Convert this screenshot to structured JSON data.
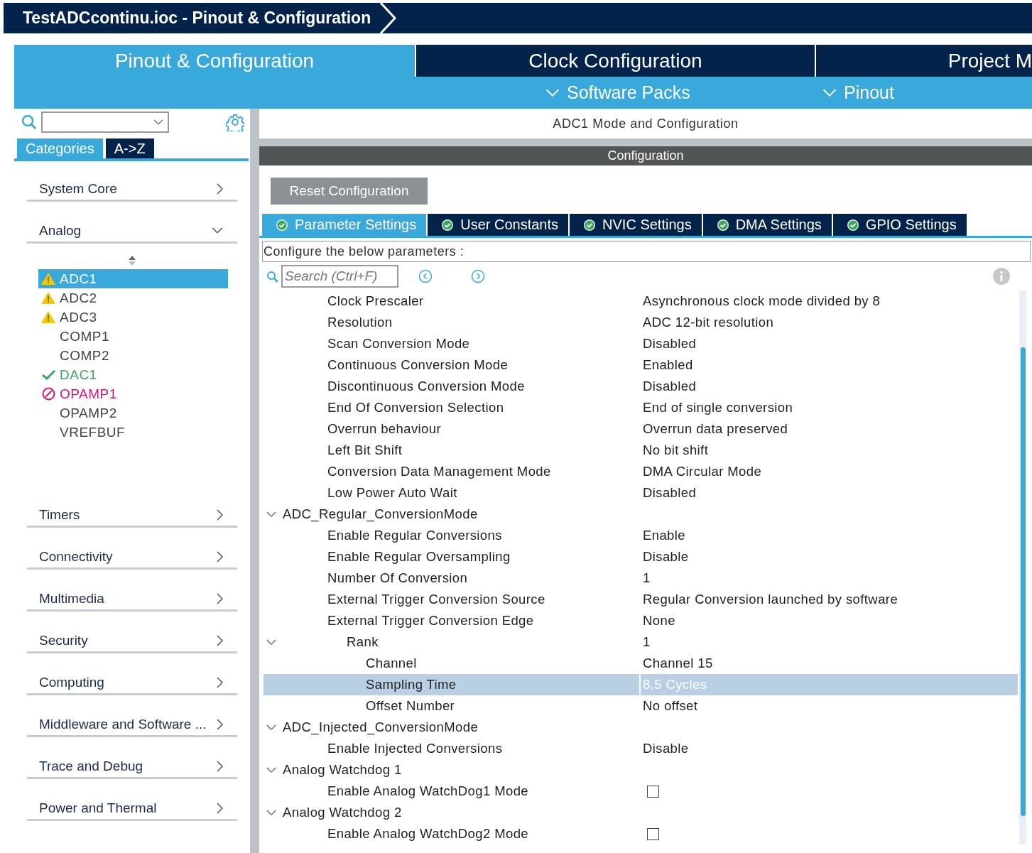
{
  "window": {
    "title": "TestADCcontinu.ioc - Pinout & Configuration"
  },
  "main_tabs": [
    {
      "label": "Pinout & Configuration",
      "selected": true
    },
    {
      "label": "Clock Configuration",
      "selected": false
    },
    {
      "label": "Project M",
      "selected": false
    }
  ],
  "sub_menu": [
    "Software Packs",
    "Pinout"
  ],
  "sidebar": {
    "view_tabs": [
      {
        "label": "Categories",
        "selected": true
      },
      {
        "label": "A->Z",
        "selected": false
      }
    ],
    "categories": [
      {
        "label": "System Core",
        "expanded": false
      },
      {
        "label": "Analog",
        "expanded": true,
        "items": [
          {
            "label": "ADC1",
            "kind": "warning",
            "selected": true
          },
          {
            "label": "ADC2",
            "kind": "warning",
            "selected": false
          },
          {
            "label": "ADC3",
            "kind": "warning",
            "selected": false
          },
          {
            "label": "COMP1",
            "kind": "plain",
            "selected": false
          },
          {
            "label": "COMP2",
            "kind": "plain",
            "selected": false
          },
          {
            "label": "DAC1",
            "kind": "ok",
            "selected": false
          },
          {
            "label": "OPAMP1",
            "kind": "error",
            "selected": false
          },
          {
            "label": "OPAMP2",
            "kind": "plain",
            "selected": false
          },
          {
            "label": "VREFBUF",
            "kind": "plain",
            "selected": false
          }
        ]
      },
      {
        "label": "Timers",
        "expanded": false
      },
      {
        "label": "Connectivity",
        "expanded": false
      },
      {
        "label": "Multimedia",
        "expanded": false
      },
      {
        "label": "Security",
        "expanded": false
      },
      {
        "label": "Computing",
        "expanded": false
      },
      {
        "label": "Middleware and Software ...",
        "expanded": false
      },
      {
        "label": "Trace and Debug",
        "expanded": false
      },
      {
        "label": "Power and Thermal",
        "expanded": false
      }
    ]
  },
  "panel": {
    "title": "ADC1 Mode and Configuration",
    "section": "Configuration",
    "reset_button": "Reset Configuration",
    "tabs": [
      {
        "label": "Parameter Settings",
        "selected": true
      },
      {
        "label": "User Constants",
        "selected": false
      },
      {
        "label": "NVIC Settings",
        "selected": false
      },
      {
        "label": "DMA Settings",
        "selected": false
      },
      {
        "label": "GPIO Settings",
        "selected": false
      }
    ],
    "description": "Configure the below parameters :",
    "search": {
      "placeholder": "Search (Ctrl+F)"
    },
    "parameters": [
      {
        "kind": "param",
        "name": "Clock Prescaler",
        "value": "Asynchronous clock mode divided by 8",
        "selected": false
      },
      {
        "kind": "param",
        "name": "Resolution",
        "value": "ADC 12-bit resolution",
        "selected": false
      },
      {
        "kind": "param",
        "name": "Scan Conversion Mode",
        "value": "Disabled",
        "selected": false
      },
      {
        "kind": "param",
        "name": "Continuous Conversion Mode",
        "value": "Enabled",
        "selected": false
      },
      {
        "kind": "param",
        "name": "Discontinuous Conversion Mode",
        "value": "Disabled",
        "selected": false
      },
      {
        "kind": "param",
        "name": "End Of Conversion Selection",
        "value": "End of single conversion",
        "selected": false
      },
      {
        "kind": "param",
        "name": "Overrun behaviour",
        "value": "Overrun data preserved",
        "selected": false
      },
      {
        "kind": "param",
        "name": "Left Bit Shift",
        "value": "No bit shift",
        "selected": false
      },
      {
        "kind": "param",
        "name": "Conversion Data Management Mode",
        "value": "DMA Circular Mode",
        "selected": false
      },
      {
        "kind": "param",
        "name": "Low Power Auto Wait",
        "value": "Disabled",
        "selected": false
      },
      {
        "kind": "group",
        "name": "ADC_Regular_ConversionMode",
        "expanded": true,
        "children": [
          {
            "kind": "param",
            "name": "Enable Regular Conversions",
            "value": "Enable",
            "selected": false
          },
          {
            "kind": "param",
            "name": "Enable Regular Oversampling",
            "value": "Disable",
            "selected": false
          },
          {
            "kind": "param",
            "name": "Number Of Conversion",
            "value": "1",
            "selected": false
          },
          {
            "kind": "param",
            "name": "External Trigger Conversion Source",
            "value": "Regular Conversion launched by software",
            "selected": false
          },
          {
            "kind": "param",
            "name": "External Trigger Conversion Edge",
            "value": "None",
            "selected": false
          },
          {
            "kind": "group",
            "name": "Rank",
            "value": "1",
            "expanded": true,
            "children": [
              {
                "kind": "param",
                "name": "Channel",
                "value": "Channel 15",
                "selected": false
              },
              {
                "kind": "param",
                "name": "Sampling Time",
                "value": "8.5 Cycles",
                "selected": true
              },
              {
                "kind": "param",
                "name": "Offset Number",
                "value": "No offset",
                "selected": false
              }
            ]
          }
        ]
      },
      {
        "kind": "group",
        "name": "ADC_Injected_ConversionMode",
        "expanded": true,
        "children": [
          {
            "kind": "param",
            "name": "Enable Injected Conversions",
            "value": "Disable",
            "selected": false
          }
        ]
      },
      {
        "kind": "group",
        "name": "Analog Watchdog 1",
        "expanded": true,
        "children": [
          {
            "kind": "checkbox",
            "name": "Enable Analog WatchDog1 Mode",
            "checked": false,
            "selected": false
          }
        ]
      },
      {
        "kind": "group",
        "name": "Analog Watchdog 2",
        "expanded": true,
        "children": [
          {
            "kind": "checkbox",
            "name": "Enable Analog WatchDog2 Mode",
            "checked": false,
            "selected": false
          }
        ]
      }
    ]
  }
}
